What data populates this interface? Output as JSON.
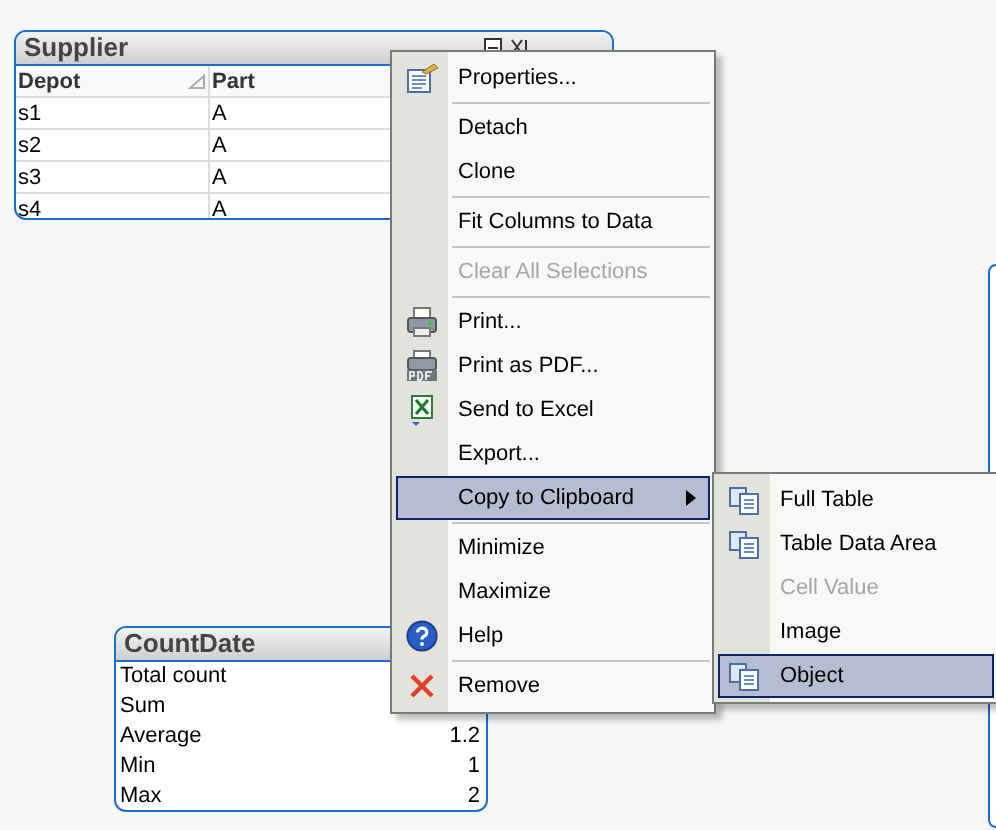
{
  "supplier": {
    "title": "Supplier",
    "columns": [
      {
        "label": "Depot",
        "sortable": true
      },
      {
        "label": "Part",
        "sortable": false
      }
    ],
    "rows": [
      [
        "s1",
        "A"
      ],
      [
        "s2",
        "A"
      ],
      [
        "s3",
        "A"
      ],
      [
        "s4",
        "A"
      ]
    ]
  },
  "countdate": {
    "title": "CountDate",
    "rows": [
      {
        "label": "Total count",
        "value": ""
      },
      {
        "label": "Sum",
        "value": ""
      },
      {
        "label": "Average",
        "value": "1.2"
      },
      {
        "label": "Min",
        "value": "1"
      },
      {
        "label": "Max",
        "value": "2"
      }
    ]
  },
  "context_menu": {
    "items": [
      {
        "kind": "item",
        "label": "Properties...",
        "disabled": false,
        "selected": false
      },
      {
        "kind": "separator"
      },
      {
        "kind": "item",
        "label": "Detach",
        "disabled": false,
        "selected": false
      },
      {
        "kind": "item",
        "label": "Clone",
        "disabled": false,
        "selected": false
      },
      {
        "kind": "separator"
      },
      {
        "kind": "item",
        "label": "Fit Columns to Data",
        "disabled": false,
        "selected": false
      },
      {
        "kind": "separator"
      },
      {
        "kind": "item",
        "label": "Clear All Selections",
        "disabled": true,
        "selected": false
      },
      {
        "kind": "separator"
      },
      {
        "kind": "item",
        "label": "Print...",
        "disabled": false,
        "selected": false
      },
      {
        "kind": "item",
        "label": "Print as PDF...",
        "disabled": false,
        "selected": false
      },
      {
        "kind": "item",
        "label": "Send to Excel",
        "disabled": false,
        "selected": false
      },
      {
        "kind": "item",
        "label": "Export...",
        "disabled": false,
        "selected": false
      },
      {
        "kind": "submenu",
        "label": "Copy to Clipboard",
        "disabled": false,
        "selected": true
      },
      {
        "kind": "separator"
      },
      {
        "kind": "item",
        "label": "Minimize",
        "disabled": false,
        "selected": false
      },
      {
        "kind": "item",
        "label": "Maximize",
        "disabled": false,
        "selected": false
      },
      {
        "kind": "item",
        "label": "Help",
        "disabled": false,
        "selected": false
      },
      {
        "kind": "separator"
      },
      {
        "kind": "item",
        "label": "Remove",
        "disabled": false,
        "selected": false
      }
    ]
  },
  "submenu": {
    "items": [
      {
        "label": "Full Table",
        "disabled": false,
        "selected": false
      },
      {
        "label": "Table Data Area",
        "disabled": false,
        "selected": false
      },
      {
        "label": "Cell Value",
        "disabled": true,
        "selected": false
      },
      {
        "label": "Image",
        "disabled": false,
        "selected": false
      },
      {
        "label": "Object",
        "disabled": false,
        "selected": true
      }
    ]
  }
}
